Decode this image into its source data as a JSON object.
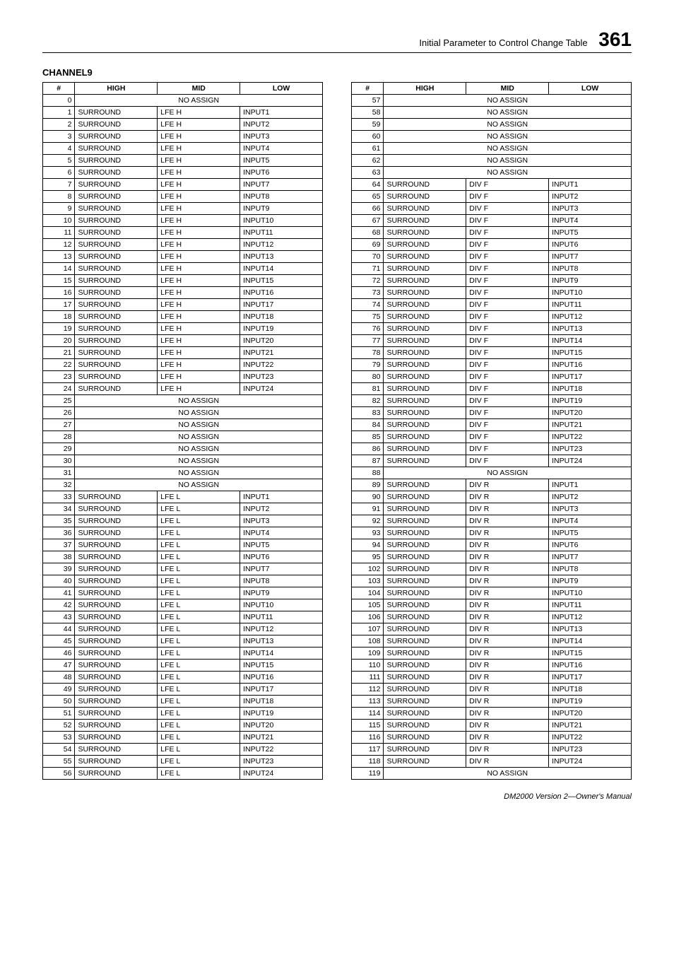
{
  "header": {
    "title": "Initial Parameter to Control Change Table",
    "page_number": "361"
  },
  "section_title": "CHANNEL9",
  "table_headers": {
    "c0": "#",
    "c1": "HIGH",
    "c2": "MID",
    "c3": "LOW"
  },
  "no_assign_label": "NO ASSIGN",
  "left_rows": [
    {
      "n": 0,
      "na": true
    },
    {
      "n": 1,
      "h": "SURROUND",
      "m": "LFE H",
      "l": "INPUT1"
    },
    {
      "n": 2,
      "h": "SURROUND",
      "m": "LFE H",
      "l": "INPUT2"
    },
    {
      "n": 3,
      "h": "SURROUND",
      "m": "LFE H",
      "l": "INPUT3"
    },
    {
      "n": 4,
      "h": "SURROUND",
      "m": "LFE H",
      "l": "INPUT4"
    },
    {
      "n": 5,
      "h": "SURROUND",
      "m": "LFE H",
      "l": "INPUT5"
    },
    {
      "n": 6,
      "h": "SURROUND",
      "m": "LFE H",
      "l": "INPUT6"
    },
    {
      "n": 7,
      "h": "SURROUND",
      "m": "LFE H",
      "l": "INPUT7"
    },
    {
      "n": 8,
      "h": "SURROUND",
      "m": "LFE H",
      "l": "INPUT8"
    },
    {
      "n": 9,
      "h": "SURROUND",
      "m": "LFE H",
      "l": "INPUT9"
    },
    {
      "n": 10,
      "h": "SURROUND",
      "m": "LFE H",
      "l": "INPUT10"
    },
    {
      "n": 11,
      "h": "SURROUND",
      "m": "LFE H",
      "l": "INPUT11"
    },
    {
      "n": 12,
      "h": "SURROUND",
      "m": "LFE H",
      "l": "INPUT12"
    },
    {
      "n": 13,
      "h": "SURROUND",
      "m": "LFE H",
      "l": "INPUT13"
    },
    {
      "n": 14,
      "h": "SURROUND",
      "m": "LFE H",
      "l": "INPUT14"
    },
    {
      "n": 15,
      "h": "SURROUND",
      "m": "LFE H",
      "l": "INPUT15"
    },
    {
      "n": 16,
      "h": "SURROUND",
      "m": "LFE H",
      "l": "INPUT16"
    },
    {
      "n": 17,
      "h": "SURROUND",
      "m": "LFE H",
      "l": "INPUT17"
    },
    {
      "n": 18,
      "h": "SURROUND",
      "m": "LFE H",
      "l": "INPUT18"
    },
    {
      "n": 19,
      "h": "SURROUND",
      "m": "LFE H",
      "l": "INPUT19"
    },
    {
      "n": 20,
      "h": "SURROUND",
      "m": "LFE H",
      "l": "INPUT20"
    },
    {
      "n": 21,
      "h": "SURROUND",
      "m": "LFE H",
      "l": "INPUT21"
    },
    {
      "n": 22,
      "h": "SURROUND",
      "m": "LFE H",
      "l": "INPUT22"
    },
    {
      "n": 23,
      "h": "SURROUND",
      "m": "LFE H",
      "l": "INPUT23"
    },
    {
      "n": 24,
      "h": "SURROUND",
      "m": "LFE H",
      "l": "INPUT24"
    },
    {
      "n": 25,
      "na": true
    },
    {
      "n": 26,
      "na": true
    },
    {
      "n": 27,
      "na": true
    },
    {
      "n": 28,
      "na": true
    },
    {
      "n": 29,
      "na": true
    },
    {
      "n": 30,
      "na": true
    },
    {
      "n": 31,
      "na": true
    },
    {
      "n": 32,
      "na": true
    },
    {
      "n": 33,
      "h": "SURROUND",
      "m": "LFE L",
      "l": "INPUT1"
    },
    {
      "n": 34,
      "h": "SURROUND",
      "m": "LFE L",
      "l": "INPUT2"
    },
    {
      "n": 35,
      "h": "SURROUND",
      "m": "LFE L",
      "l": "INPUT3"
    },
    {
      "n": 36,
      "h": "SURROUND",
      "m": "LFE L",
      "l": "INPUT4"
    },
    {
      "n": 37,
      "h": "SURROUND",
      "m": "LFE L",
      "l": "INPUT5"
    },
    {
      "n": 38,
      "h": "SURROUND",
      "m": "LFE L",
      "l": "INPUT6"
    },
    {
      "n": 39,
      "h": "SURROUND",
      "m": "LFE L",
      "l": "INPUT7"
    },
    {
      "n": 40,
      "h": "SURROUND",
      "m": "LFE L",
      "l": "INPUT8"
    },
    {
      "n": 41,
      "h": "SURROUND",
      "m": "LFE L",
      "l": "INPUT9"
    },
    {
      "n": 42,
      "h": "SURROUND",
      "m": "LFE L",
      "l": "INPUT10"
    },
    {
      "n": 43,
      "h": "SURROUND",
      "m": "LFE L",
      "l": "INPUT11"
    },
    {
      "n": 44,
      "h": "SURROUND",
      "m": "LFE L",
      "l": "INPUT12"
    },
    {
      "n": 45,
      "h": "SURROUND",
      "m": "LFE L",
      "l": "INPUT13"
    },
    {
      "n": 46,
      "h": "SURROUND",
      "m": "LFE L",
      "l": "INPUT14"
    },
    {
      "n": 47,
      "h": "SURROUND",
      "m": "LFE L",
      "l": "INPUT15"
    },
    {
      "n": 48,
      "h": "SURROUND",
      "m": "LFE L",
      "l": "INPUT16"
    },
    {
      "n": 49,
      "h": "SURROUND",
      "m": "LFE L",
      "l": "INPUT17"
    },
    {
      "n": 50,
      "h": "SURROUND",
      "m": "LFE L",
      "l": "INPUT18"
    },
    {
      "n": 51,
      "h": "SURROUND",
      "m": "LFE L",
      "l": "INPUT19"
    },
    {
      "n": 52,
      "h": "SURROUND",
      "m": "LFE L",
      "l": "INPUT20"
    },
    {
      "n": 53,
      "h": "SURROUND",
      "m": "LFE L",
      "l": "INPUT21"
    },
    {
      "n": 54,
      "h": "SURROUND",
      "m": "LFE L",
      "l": "INPUT22"
    },
    {
      "n": 55,
      "h": "SURROUND",
      "m": "LFE L",
      "l": "INPUT23"
    },
    {
      "n": 56,
      "h": "SURROUND",
      "m": "LFE L",
      "l": "INPUT24"
    }
  ],
  "right_rows": [
    {
      "n": 57,
      "na": true
    },
    {
      "n": 58,
      "na": true
    },
    {
      "n": 59,
      "na": true
    },
    {
      "n": 60,
      "na": true
    },
    {
      "n": 61,
      "na": true
    },
    {
      "n": 62,
      "na": true
    },
    {
      "n": 63,
      "na": true
    },
    {
      "n": 64,
      "h": "SURROUND",
      "m": "DIV F",
      "l": "INPUT1"
    },
    {
      "n": 65,
      "h": "SURROUND",
      "m": "DIV F",
      "l": "INPUT2"
    },
    {
      "n": 66,
      "h": "SURROUND",
      "m": "DIV F",
      "l": "INPUT3"
    },
    {
      "n": 67,
      "h": "SURROUND",
      "m": "DIV F",
      "l": "INPUT4"
    },
    {
      "n": 68,
      "h": "SURROUND",
      "m": "DIV F",
      "l": "INPUT5"
    },
    {
      "n": 69,
      "h": "SURROUND",
      "m": "DIV F",
      "l": "INPUT6"
    },
    {
      "n": 70,
      "h": "SURROUND",
      "m": "DIV F",
      "l": "INPUT7"
    },
    {
      "n": 71,
      "h": "SURROUND",
      "m": "DIV F",
      "l": "INPUT8"
    },
    {
      "n": 72,
      "h": "SURROUND",
      "m": "DIV F",
      "l": "INPUT9"
    },
    {
      "n": 73,
      "h": "SURROUND",
      "m": "DIV F",
      "l": "INPUT10"
    },
    {
      "n": 74,
      "h": "SURROUND",
      "m": "DIV F",
      "l": "INPUT11"
    },
    {
      "n": 75,
      "h": "SURROUND",
      "m": "DIV F",
      "l": "INPUT12"
    },
    {
      "n": 76,
      "h": "SURROUND",
      "m": "DIV F",
      "l": "INPUT13"
    },
    {
      "n": 77,
      "h": "SURROUND",
      "m": "DIV F",
      "l": "INPUT14"
    },
    {
      "n": 78,
      "h": "SURROUND",
      "m": "DIV F",
      "l": "INPUT15"
    },
    {
      "n": 79,
      "h": "SURROUND",
      "m": "DIV F",
      "l": "INPUT16"
    },
    {
      "n": 80,
      "h": "SURROUND",
      "m": "DIV F",
      "l": "INPUT17"
    },
    {
      "n": 81,
      "h": "SURROUND",
      "m": "DIV F",
      "l": "INPUT18"
    },
    {
      "n": 82,
      "h": "SURROUND",
      "m": "DIV F",
      "l": "INPUT19"
    },
    {
      "n": 83,
      "h": "SURROUND",
      "m": "DIV F",
      "l": "INPUT20"
    },
    {
      "n": 84,
      "h": "SURROUND",
      "m": "DIV F",
      "l": "INPUT21"
    },
    {
      "n": 85,
      "h": "SURROUND",
      "m": "DIV F",
      "l": "INPUT22"
    },
    {
      "n": 86,
      "h": "SURROUND",
      "m": "DIV F",
      "l": "INPUT23"
    },
    {
      "n": 87,
      "h": "SURROUND",
      "m": "DIV F",
      "l": "INPUT24"
    },
    {
      "n": 88,
      "na": true
    },
    {
      "n": 89,
      "h": "SURROUND",
      "m": "DIV R",
      "l": "INPUT1"
    },
    {
      "n": 90,
      "h": "SURROUND",
      "m": "DIV R",
      "l": "INPUT2"
    },
    {
      "n": 91,
      "h": "SURROUND",
      "m": "DIV R",
      "l": "INPUT3"
    },
    {
      "n": 92,
      "h": "SURROUND",
      "m": "DIV R",
      "l": "INPUT4"
    },
    {
      "n": 93,
      "h": "SURROUND",
      "m": "DIV R",
      "l": "INPUT5"
    },
    {
      "n": 94,
      "h": "SURROUND",
      "m": "DIV R",
      "l": "INPUT6"
    },
    {
      "n": 95,
      "h": "SURROUND",
      "m": "DIV R",
      "l": "INPUT7"
    },
    {
      "n": 102,
      "h": "SURROUND",
      "m": "DIV R",
      "l": "INPUT8"
    },
    {
      "n": 103,
      "h": "SURROUND",
      "m": "DIV R",
      "l": "INPUT9"
    },
    {
      "n": 104,
      "h": "SURROUND",
      "m": "DIV R",
      "l": "INPUT10"
    },
    {
      "n": 105,
      "h": "SURROUND",
      "m": "DIV R",
      "l": "INPUT11"
    },
    {
      "n": 106,
      "h": "SURROUND",
      "m": "DIV R",
      "l": "INPUT12"
    },
    {
      "n": 107,
      "h": "SURROUND",
      "m": "DIV R",
      "l": "INPUT13"
    },
    {
      "n": 108,
      "h": "SURROUND",
      "m": "DIV R",
      "l": "INPUT14"
    },
    {
      "n": 109,
      "h": "SURROUND",
      "m": "DIV R",
      "l": "INPUT15"
    },
    {
      "n": 110,
      "h": "SURROUND",
      "m": "DIV R",
      "l": "INPUT16"
    },
    {
      "n": 111,
      "h": "SURROUND",
      "m": "DIV R",
      "l": "INPUT17"
    },
    {
      "n": 112,
      "h": "SURROUND",
      "m": "DIV R",
      "l": "INPUT18"
    },
    {
      "n": 113,
      "h": "SURROUND",
      "m": "DIV R",
      "l": "INPUT19"
    },
    {
      "n": 114,
      "h": "SURROUND",
      "m": "DIV R",
      "l": "INPUT20"
    },
    {
      "n": 115,
      "h": "SURROUND",
      "m": "DIV R",
      "l": "INPUT21"
    },
    {
      "n": 116,
      "h": "SURROUND",
      "m": "DIV R",
      "l": "INPUT22"
    },
    {
      "n": 117,
      "h": "SURROUND",
      "m": "DIV R",
      "l": "INPUT23"
    },
    {
      "n": 118,
      "h": "SURROUND",
      "m": "DIV R",
      "l": "INPUT24"
    },
    {
      "n": 119,
      "na": true
    }
  ],
  "footer": "DM2000 Version 2—Owner's Manual"
}
